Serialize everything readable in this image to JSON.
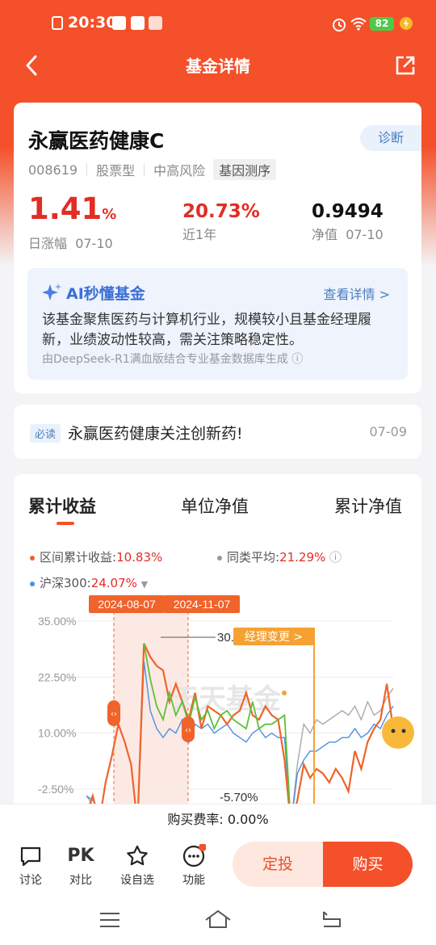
{
  "status": {
    "time": "20:30",
    "battery": "82"
  },
  "nav": {
    "title": "基金详情"
  },
  "fund": {
    "name": "永赢医药健康C",
    "diag_label": "诊断",
    "code": "008619",
    "type": "股票型",
    "risk": "中高风险",
    "gene_tag": "基因测序",
    "daily_change": "1.41",
    "daily_unit": "%",
    "daily_label": "日涨幅",
    "daily_date": "07-10",
    "year_return": "20.73%",
    "year_label": "近1年",
    "nav_value": "0.9494",
    "nav_label": "净值",
    "nav_date": "07-10"
  },
  "ai": {
    "title": "AI秒懂基金",
    "more": "查看详情 >",
    "text": "该基金聚焦医药与计算机行业，规模较小且基金经理履新，业绩波动性较高，需关注策略稳定性。",
    "source": "由DeepSeek-R1满血版结合专业基金数据库生成 ⓘ"
  },
  "news": {
    "tag": "必读",
    "text": "永赢医药健康关注创新药!",
    "date": "07-09"
  },
  "chart": {
    "tabs": [
      "累计收益",
      "单位净值",
      "累计净值"
    ],
    "legend": {
      "range_label": "区间累计收益:",
      "range_value": "10.83%",
      "peer_label": "同类平均:",
      "peer_value": "21.29%",
      "hs300_label": "沪深300:",
      "hs300_value": "24.07%"
    },
    "date_tags": [
      "2024-08-07",
      "2024-11-07"
    ],
    "peak_label": "30.11%",
    "low_label": "-5.70%",
    "manager_change": "经理变更 >",
    "watermark": "天天基金",
    "colors": {
      "fund": "#f0632b",
      "peer": "#aaaaaa",
      "hs300": "#4a90e2",
      "highlight": "#5dc23a"
    }
  },
  "chart_data": {
    "type": "line",
    "ylim": [
      -2.5,
      35
    ],
    "yticks": [
      "35.00%",
      "22.50%",
      "10.00%",
      "-2.50%"
    ],
    "ytick_values": [
      35,
      22.5,
      10,
      -2.5
    ],
    "series": [
      {
        "name": "区间累计收益",
        "values": [
          -8,
          -4,
          -10,
          -1,
          5,
          12,
          8,
          3,
          -12,
          30,
          27,
          25,
          24,
          17,
          21,
          17,
          13,
          19,
          11,
          16,
          15,
          14,
          12,
          14,
          15,
          19,
          14,
          13,
          16,
          14,
          13,
          4,
          -12,
          -5,
          3,
          0,
          2,
          1,
          -1,
          2,
          0,
          -3,
          6,
          2,
          8,
          11,
          13,
          21,
          11
        ]
      },
      {
        "name": "同类平均",
        "values": [
          -4,
          -6,
          -9,
          -11,
          -12,
          -14,
          -16,
          -18,
          -20,
          30,
          22,
          16,
          13,
          19,
          14,
          17,
          12,
          18,
          13,
          15,
          11,
          14,
          15,
          13,
          12,
          11,
          17,
          11,
          12,
          12,
          13,
          14,
          -11,
          3,
          12,
          10,
          13,
          12,
          13,
          14,
          15,
          14,
          16,
          13,
          17,
          14,
          15,
          18,
          20
        ]
      },
      {
        "name": "沪深300",
        "values": [
          -4,
          -5,
          -7,
          -9,
          -11,
          -12,
          -14,
          -15,
          -17,
          26,
          15,
          11,
          9,
          11,
          10,
          13,
          8,
          12,
          11,
          12,
          10,
          11,
          12,
          10,
          9,
          8,
          10,
          11,
          9,
          10,
          9,
          9,
          -12,
          1,
          4,
          6,
          6,
          7,
          8,
          8,
          9,
          9,
          11,
          9,
          10,
          12,
          11,
          14,
          16
        ]
      }
    ]
  },
  "footer": {
    "fee": "购买费率: 0.00%"
  },
  "toolbar": {
    "discuss": "讨论",
    "pk": "PK",
    "compare": "对比",
    "watch": "设自选",
    "func": "功能",
    "fixed": "定投",
    "buy": "购买"
  }
}
